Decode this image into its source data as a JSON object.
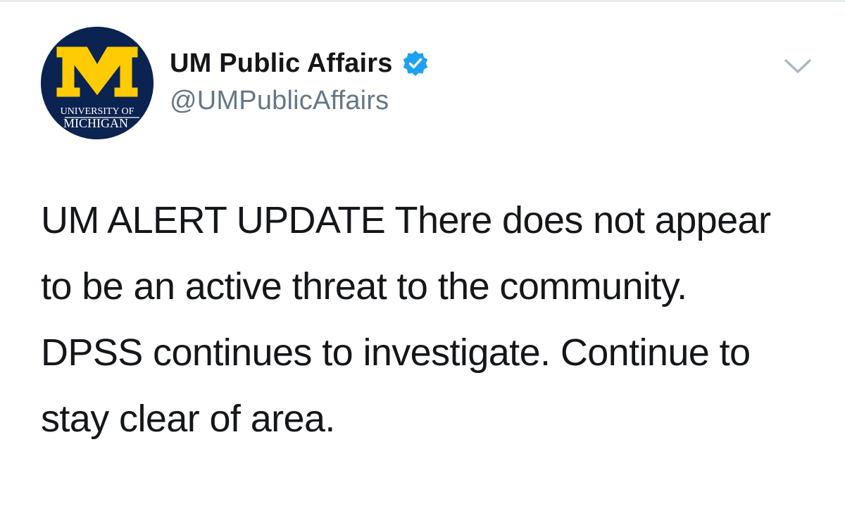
{
  "tweet": {
    "author": {
      "display_name": "UM Public Affairs",
      "handle": "@UMPublicAffairs",
      "verified": true,
      "avatar": {
        "letter": "M",
        "line1": "UNIVERSITY OF",
        "line2": "MICHIGAN"
      }
    },
    "text": "UM ALERT UPDATE There does not appear to be an active threat to the community. DPSS continues to investigate. Continue to stay clear of area."
  },
  "icons": {
    "verified": "verified-badge-icon",
    "menu": "chevron-down-icon"
  },
  "colors": {
    "verified_blue": "#1da1f2",
    "maize": "#ffcb05",
    "michigan_blue": "#0b2350",
    "handle_gray": "#657786",
    "chevron_gray": "#aab8c2"
  }
}
